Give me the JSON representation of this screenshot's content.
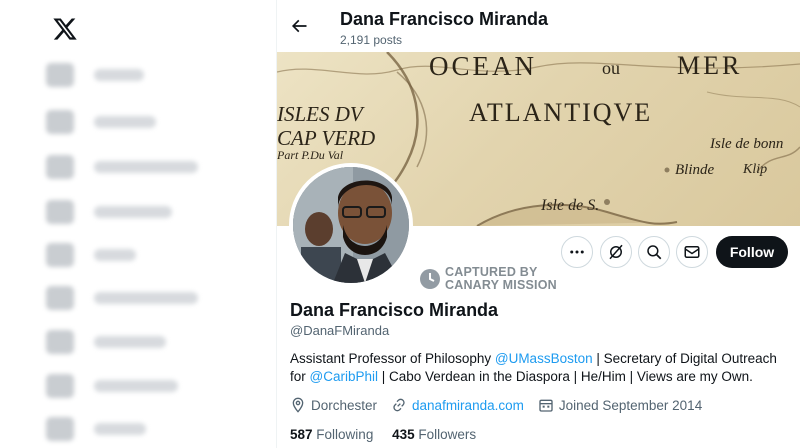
{
  "header": {
    "name": "Dana Francisco Miranda",
    "posts": "2,191 posts"
  },
  "banner": {
    "map_words": [
      "OCEAN",
      "ou",
      "MER",
      "ISLES DV",
      "ATLANTIQVE",
      "CAP VERD",
      "Part P.Du Val",
      "Isle de bonn",
      "Blinde",
      "Klip",
      "Isle de S."
    ]
  },
  "watermark": {
    "line1": "CAPTURED BY",
    "line2": "CANARY MISSION"
  },
  "actions": {
    "more_icon": "more-icon",
    "grok_icon": "grok-icon",
    "search_icon": "search-icon",
    "message_icon": "mail-icon",
    "follow_label": "Follow"
  },
  "profile": {
    "name": "Dana Francisco Miranda",
    "handle": "@DanaFMiranda",
    "bio": {
      "part1": "Assistant Professor of Philosophy ",
      "mention1": "@UMassBoston",
      "part2": " | Secretary of Digital Outreach for ",
      "mention2": "@CaribPhil",
      "part3": " | Cabo Verdean in the Diaspora | He/Him | Views are my Own."
    },
    "location": "Dorchester",
    "website": "danafmiranda.com",
    "joined": "Joined September 2014",
    "following_count": "587",
    "following_label": "Following",
    "followers_count": "435",
    "followers_label": "Followers"
  },
  "colors": {
    "accent": "#1d9bf0",
    "text": "#0f1419",
    "muted": "#536471",
    "follow_bg": "#0f1419"
  }
}
